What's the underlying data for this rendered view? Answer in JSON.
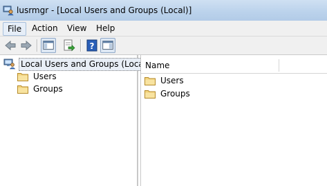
{
  "window": {
    "title": "lusrmgr - [Local Users and Groups (Local)]"
  },
  "menu": {
    "items": [
      {
        "label": "File"
      },
      {
        "label": "Action"
      },
      {
        "label": "View"
      },
      {
        "label": "Help"
      }
    ]
  },
  "toolbar": {
    "buttons": [
      {
        "icon": "back-arrow-icon"
      },
      {
        "icon": "forward-arrow-icon"
      },
      {
        "icon": "show-hide-console-tree-icon"
      },
      {
        "icon": "export-list-icon"
      },
      {
        "icon": "help-icon"
      },
      {
        "icon": "show-hide-action-pane-icon"
      }
    ]
  },
  "tree": {
    "root": {
      "label": "Local Users and Groups (Local)",
      "icon": "computer-users-icon"
    },
    "children": [
      {
        "label": "Users",
        "icon": "folder-icon"
      },
      {
        "label": "Groups",
        "icon": "folder-icon"
      }
    ]
  },
  "list": {
    "columns": [
      {
        "label": "Name"
      }
    ],
    "items": [
      {
        "label": "Users",
        "icon": "folder-icon"
      },
      {
        "label": "Groups",
        "icon": "folder-icon"
      }
    ]
  },
  "colors": {
    "titlebar": "#bcd3ec",
    "chrome": "#f0f0f0",
    "folder": "#f2d37c",
    "selection": "#e8eef6"
  }
}
